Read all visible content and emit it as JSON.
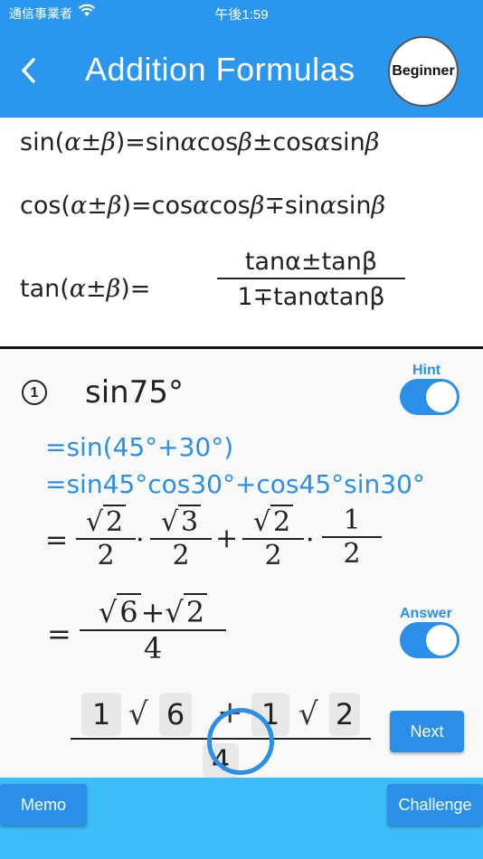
{
  "status": {
    "carrier": "通信事業者",
    "time": "午後1:59"
  },
  "header": {
    "title": "Addition Formulas",
    "level": "Beginner"
  },
  "formulas": {
    "sin_left": "sin(",
    "sin_ab": "α±β",
    "sin_right": ")=sin",
    "sin_a1": "α",
    "sin_cos": "cos",
    "sin_b1": "β",
    "sin_pm": "±cos",
    "sin_a2": "α",
    "sin_sin": "sin",
    "sin_b2": "β",
    "cos_left": "cos(",
    "cos_ab": "α±β",
    "cos_right": ")=cos",
    "cos_a1": "α",
    "cos_cos": "cos",
    "cos_b1": "β",
    "cos_mp": "∓sin",
    "cos_a2": "α",
    "cos_sin": "sin",
    "cos_b2": "β",
    "tan_left": "tan(",
    "tan_ab": "α±β",
    "tan_right": ")=",
    "tan_num": "tanα±tanβ",
    "tan_den": "1∓tanαtanβ"
  },
  "question": {
    "number": "1",
    "text": "sin75°",
    "hint_label": "Hint",
    "answer_label": "Answer",
    "step1": "=sin(45°+30°)",
    "step2": "=sin45°cos30°+cos45°sin30°",
    "step3": {
      "eq": "=",
      "f1_num": "2",
      "f1_den": "2",
      "dot1": "·",
      "f2_num": "3",
      "f2_den": "2",
      "plus": "+",
      "f3_num": "2",
      "f3_den": "2",
      "dot2": "·",
      "f4_num": "1",
      "f4_den": "2"
    },
    "step4": {
      "eq": "=",
      "r1": "6",
      "plus": "+",
      "r2": "2",
      "den": "4"
    },
    "answer": {
      "c1": "1",
      "r1": "6",
      "plus": "+",
      "c2": "1",
      "r2": "2",
      "den": "4"
    }
  },
  "buttons": {
    "next": "Next",
    "memo": "Memo",
    "challenge": "Challenge"
  },
  "colors": {
    "header": "#2b96ee",
    "accent": "#2b8fe8",
    "footer": "#3cbdf7"
  },
  "icons": {
    "back": "chevron-left-icon",
    "wifi": "wifi-icon",
    "circle": "circled-number"
  }
}
